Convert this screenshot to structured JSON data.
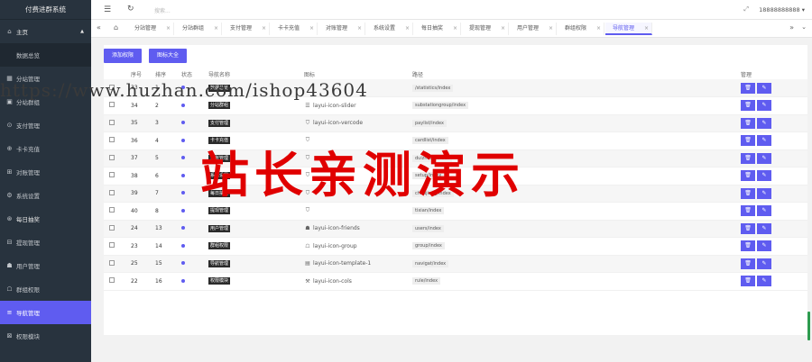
{
  "app": {
    "title": "付费进群系统"
  },
  "sidebar": {
    "items": [
      {
        "label": "主页",
        "icon": "home-icon",
        "glyph": "⌂"
      },
      {
        "label": "数据总览",
        "icon": "",
        "glyph": ""
      },
      {
        "label": "分站管理",
        "icon": "grid-icon",
        "glyph": "▦"
      },
      {
        "label": "分站群组",
        "icon": "users-icon",
        "glyph": "▣"
      },
      {
        "label": "支付管理",
        "icon": "pay-icon",
        "glyph": "⊙"
      },
      {
        "label": "卡卡充值",
        "icon": "card-icon",
        "glyph": "⊕"
      },
      {
        "label": "对账管理",
        "icon": "ledger-icon",
        "glyph": "⊞"
      },
      {
        "label": "系统设置",
        "icon": "gear-icon",
        "glyph": "⚙"
      },
      {
        "label": "每日抽奖",
        "icon": "gift-icon",
        "glyph": "⊛"
      },
      {
        "label": "提现管理",
        "icon": "withdraw-icon",
        "glyph": "⊟"
      },
      {
        "label": "用户管理",
        "icon": "user-icon",
        "glyph": "☗"
      },
      {
        "label": "群组权限",
        "icon": "group-icon",
        "glyph": "☖"
      },
      {
        "label": "导航管理",
        "icon": "nav-icon",
        "glyph": "≡"
      },
      {
        "label": "权限模块",
        "icon": "module-icon",
        "glyph": "⊠"
      }
    ]
  },
  "header": {
    "search_placeholder": "搜索...",
    "user": "18888888888"
  },
  "tabs": [
    {
      "label": "分站管理"
    },
    {
      "label": "分站群组"
    },
    {
      "label": "支付管理"
    },
    {
      "label": "卡卡充值"
    },
    {
      "label": "对账管理"
    },
    {
      "label": "系统设置"
    },
    {
      "label": "每日抽奖"
    },
    {
      "label": "提现管理"
    },
    {
      "label": "用户管理"
    },
    {
      "label": "群组权限"
    },
    {
      "label": "导航管理"
    }
  ],
  "toolbar": {
    "add_label": "添加权限",
    "icons_label": "图标大全"
  },
  "table": {
    "columns": [
      "",
      "序号",
      "排序",
      "状态",
      "导航名称",
      "图标",
      "路径",
      "管理"
    ],
    "rows": [
      {
        "id": "33",
        "sort": "1",
        "name": "数据总览",
        "icon_glyph": "",
        "icon": "",
        "path": "/statistics/index"
      },
      {
        "id": "34",
        "sort": "2",
        "name": "分站群组",
        "icon_glyph": "☰",
        "icon": "layui-icon-slider",
        "path": "substationgroup/index"
      },
      {
        "id": "35",
        "sort": "3",
        "name": "支付管理",
        "icon_glyph": "⛉",
        "icon": "layui-icon-vercode",
        "path": "paylist/index"
      },
      {
        "id": "36",
        "sort": "4",
        "name": "卡卡充值",
        "icon_glyph": "⛉",
        "icon": "",
        "path": "cardlist/index"
      },
      {
        "id": "37",
        "sort": "5",
        "name": "对账管理",
        "icon_glyph": "⛉",
        "icon": "",
        "path": "duizhang/index"
      },
      {
        "id": "38",
        "sort": "6",
        "name": "系统设置",
        "icon_glyph": "⛉",
        "icon": "",
        "path": "setup/index"
      },
      {
        "id": "39",
        "sort": "7",
        "name": "每日抽奖",
        "icon_glyph": "⛉",
        "icon": "",
        "path": "choujiang/index"
      },
      {
        "id": "40",
        "sort": "8",
        "name": "提现管理",
        "icon_glyph": "⛉",
        "icon": "",
        "path": "tixian/index"
      },
      {
        "id": "24",
        "sort": "13",
        "name": "用户管理",
        "icon_glyph": "☗",
        "icon": "layui-icon-friends",
        "path": "users/index"
      },
      {
        "id": "23",
        "sort": "14",
        "name": "群组权限",
        "icon_glyph": "☖",
        "icon": "layui-icon-group",
        "path": "group/index"
      },
      {
        "id": "25",
        "sort": "15",
        "name": "导航管理",
        "icon_glyph": "▤",
        "icon": "layui-icon-template-1",
        "path": "navigat/index"
      },
      {
        "id": "22",
        "sort": "16",
        "name": "权限模块",
        "icon_glyph": "⚒",
        "icon": "layui-icon-cols",
        "path": "rule/index"
      }
    ]
  },
  "watermark": {
    "url": "https://www.huzhan.com/ishop43604",
    "text": "站长亲测演示"
  },
  "colors": {
    "accent": "#5f5cf0",
    "sidebar_bg": "#28333e"
  }
}
